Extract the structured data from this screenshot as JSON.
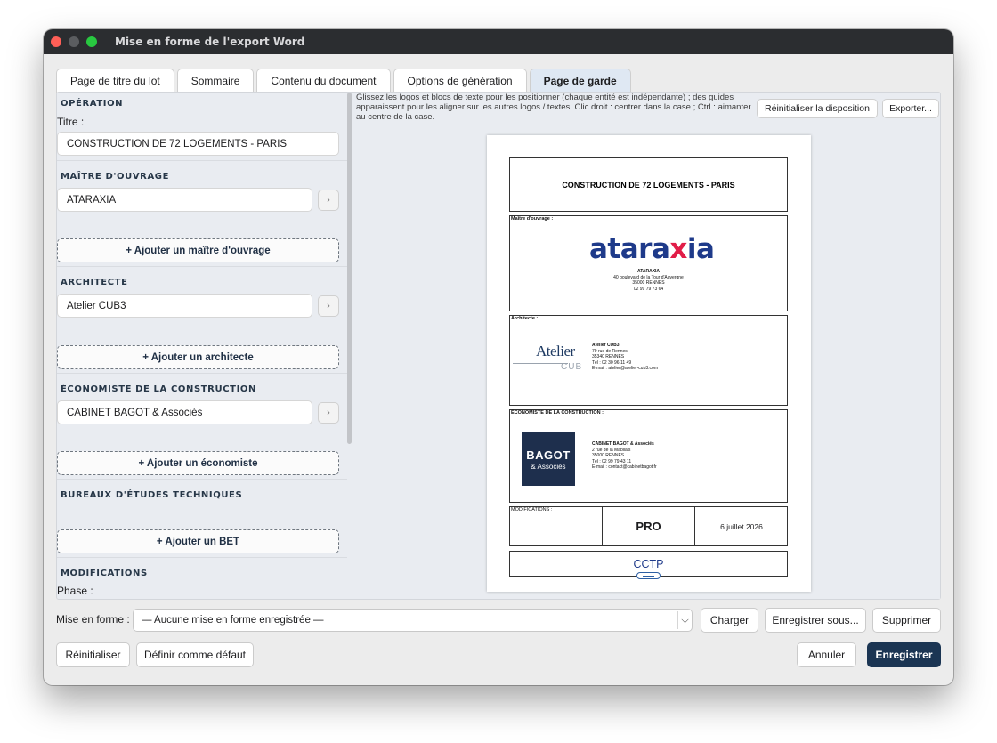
{
  "window": {
    "title": "Mise en forme de l'export Word"
  },
  "tabs": [
    {
      "label": "Page de titre du lot",
      "active": false
    },
    {
      "label": "Sommaire",
      "active": false
    },
    {
      "label": "Contenu du document",
      "active": false
    },
    {
      "label": "Options de génération",
      "active": false
    },
    {
      "label": "Page de garde",
      "active": true
    }
  ],
  "left": {
    "operation": {
      "heading": "OPÉRATION",
      "title_label": "Titre :",
      "title_value": "CONSTRUCTION DE 72 LOGEMENTS - PARIS"
    },
    "moa": {
      "heading": "MAÎTRE D'OUVRAGE",
      "value": "ATARAXIA",
      "add": "+ Ajouter un maître d'ouvrage"
    },
    "architecte": {
      "heading": "ARCHITECTE",
      "value": "Atelier CUB3",
      "add": "+ Ajouter un architecte"
    },
    "economiste": {
      "heading": "ÉCONOMISTE DE LA CONSTRUCTION",
      "value": "CABINET BAGOT & Associés",
      "add": "+ Ajouter un économiste"
    },
    "bet": {
      "heading": "BUREAUX D'ÉTUDES TECHNIQUES",
      "add": "+ Ajouter un BET"
    },
    "modifications": {
      "heading": "MODIFICATIONS",
      "phase_label": "Phase :"
    }
  },
  "hint": "Glissez les logos et blocs de texte pour les positionner (chaque entité est indépendante) ; des guides apparaissent pour les aligner sur les autres logos / textes. Clic droit : centrer dans la case ; Ctrl : aimanter au centre de la case.",
  "toolbar": {
    "reset_layout": "Réinitialiser la disposition",
    "export": "Exporter..."
  },
  "preview": {
    "title": "CONSTRUCTION DE 72 LOGEMENTS - PARIS",
    "moa": {
      "label": "Maître d'ouvrage :",
      "logo": "ataraxia",
      "lines": [
        "ATARAXIA",
        "40 boulevard de la Tour d'Auvergne",
        "35000 RENNES",
        "02 99 79 73 64"
      ]
    },
    "architecte": {
      "label": "Architecte :",
      "logo_top": "Atelier",
      "logo_bottom": "CUB",
      "lines": [
        "Atelier CUB3",
        "79 rue de Rennes",
        "35340 RENNES",
        "Tél : 02 30 96 11 49",
        "E-mail : atelier@atelier-cub3.com"
      ]
    },
    "economiste": {
      "label": "ÉCONOMISTE DE LA CONSTRUCTION :",
      "logo_top": "BAGOT",
      "logo_bottom": "& Associés",
      "lines": [
        "CABINET BAGOT & Associés",
        "2 rue de la Mabilais",
        "35000 RENNES",
        "Tél : 02 99 79 43 11",
        "E-mail : contact@cabinetbagot.fr"
      ]
    },
    "modifications": {
      "label": "MODIFICATIONS :",
      "phase": "PRO",
      "date": "6 juillet 2026"
    },
    "doc_type": "CCTP"
  },
  "bottom": {
    "preset_label": "Mise en forme :",
    "preset_value": "— Aucune mise en forme enregistrée —",
    "load": "Charger",
    "save_as": "Enregistrer sous...",
    "delete": "Supprimer",
    "reset": "Réinitialiser",
    "set_default": "Définir comme défaut",
    "cancel": "Annuler",
    "save": "Enregistrer"
  },
  "colors": {
    "accent": "#1b3553",
    "active_tab": "#dfe8f3",
    "ataraxia_blue": "#1e3a8a",
    "ataraxia_red": "#e11d48",
    "bagot_navy": "#1e2f4d"
  }
}
